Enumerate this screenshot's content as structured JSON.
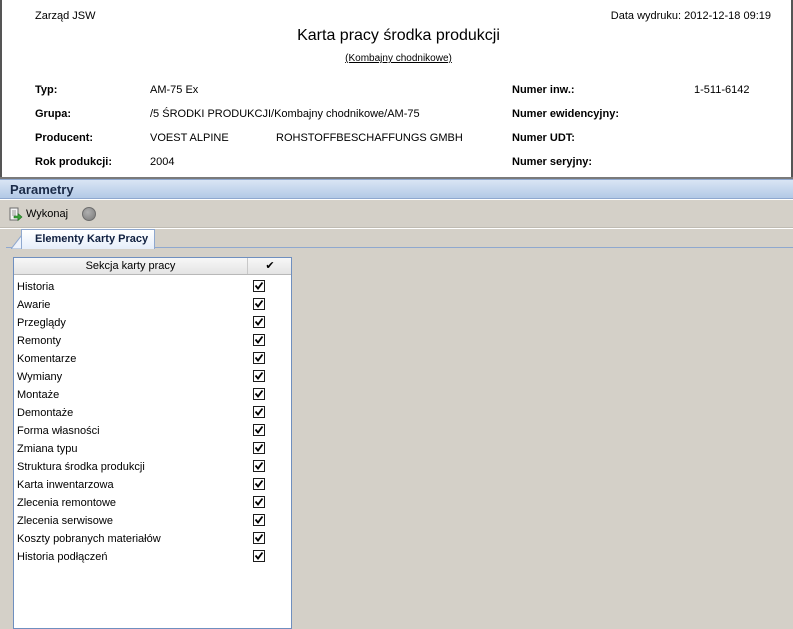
{
  "report": {
    "company": "Zarząd JSW",
    "print_date": "Data wydruku: 2012-12-18 09:19",
    "title": "Karta pracy środka produkcji",
    "subtitle": "(Kombajny chodnikowe)",
    "fields": {
      "typ_label": "Typ:",
      "typ_value": "AM-75 Ex",
      "grupa_label": "Grupa:",
      "grupa_value": "/5 ŚRODKI PRODUKCJI/Kombajny chodnikowe/AM-75",
      "producent_label": "Producent:",
      "producent_value_1": "VOEST ALPINE",
      "producent_value_2": "ROHSTOFFBESCHAFFUNGS GMBH",
      "rok_label": "Rok produkcji:",
      "rok_value": "2004",
      "numer_inw_label": "Numer inw.:",
      "numer_inw_value": "1-511-6142",
      "numer_ewid_label": "Numer ewidencyjny:",
      "numer_udt_label": "Numer UDT:",
      "numer_ser_label": "Numer seryjny:"
    }
  },
  "params": {
    "header": "Parametry",
    "toolbar": {
      "run_label": "Wykonaj",
      "run_icon": "run-arrow-icon",
      "stop_icon": "stop-circle-icon"
    },
    "tab_label": "Elementy Karty Pracy",
    "grid": {
      "col_section": "Sekcja karty pracy",
      "col_check": "✔",
      "rows": [
        {
          "name": "Historia",
          "checked": true
        },
        {
          "name": "Awarie",
          "checked": true
        },
        {
          "name": "Przeglądy",
          "checked": true
        },
        {
          "name": "Remonty",
          "checked": true
        },
        {
          "name": "Komentarze",
          "checked": true
        },
        {
          "name": "Wymiany",
          "checked": true
        },
        {
          "name": "Montaże",
          "checked": true
        },
        {
          "name": "Demontaże",
          "checked": true
        },
        {
          "name": "Forma własności",
          "checked": true
        },
        {
          "name": "Zmiana typu",
          "checked": true
        },
        {
          "name": "Struktura środka produkcji",
          "checked": true
        },
        {
          "name": "Karta inwentarzowa",
          "checked": true
        },
        {
          "name": "Zlecenia remontowe",
          "checked": true
        },
        {
          "name": "Zlecenia serwisowe",
          "checked": true
        },
        {
          "name": "Koszty pobranych materiałów",
          "checked": true
        },
        {
          "name": "Historia podłączeń",
          "checked": true
        }
      ]
    }
  },
  "colors": {
    "panel_bg": "#d4d0c8",
    "header_gradient_top": "#d9e5f4",
    "header_gradient_bottom": "#b3c9e6",
    "grid_border": "#6f8fbf"
  }
}
